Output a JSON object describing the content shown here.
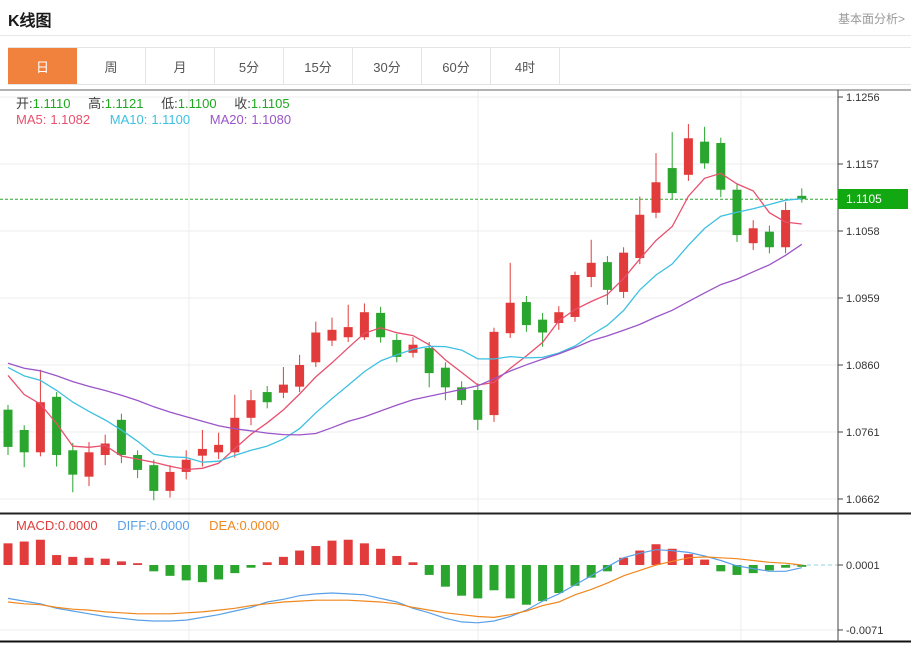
{
  "header": {
    "title": "K线图",
    "link": "基本面分析>"
  },
  "tabs": {
    "items": [
      "日",
      "周",
      "月",
      "5分",
      "15分",
      "30分",
      "60分",
      "4时"
    ],
    "active_index": 0
  },
  "legend": {
    "ohlc": [
      {
        "label": "开:",
        "value": "1.1110"
      },
      {
        "label": "高:",
        "value": "1.1121"
      },
      {
        "label": "低:",
        "value": "1.1100"
      },
      {
        "label": "收:",
        "value": "1.1105"
      }
    ],
    "ma": [
      {
        "label": "MA5:",
        "value": "1.1082",
        "color": "#e8506e"
      },
      {
        "label": "MA10:",
        "value": "1.1100",
        "color": "#3ec0e0"
      },
      {
        "label": "MA20:",
        "value": "1.1080",
        "color": "#9b55c8"
      }
    ]
  },
  "macd_legend": [
    {
      "label": "MACD:",
      "value": "0.0000",
      "color": "#e13b3b"
    },
    {
      "label": "DIFF:",
      "value": "0.0000",
      "color": "#5aa0e6"
    },
    {
      "label": "DEA:",
      "value": "0.0000",
      "color": "#f0871e"
    }
  ],
  "price_badge": {
    "value": "1.1105"
  },
  "colors": {
    "up": "#e13b3b",
    "down": "#2aa52d",
    "badge": "#12a812",
    "dashed_price": "#2fa82f",
    "ma5": "#e8506e",
    "ma10": "#3ec0e0",
    "ma20": "#9b55c8",
    "diff": "#5aa0e6",
    "dea": "#f0871e",
    "tab_active": "#f0823d",
    "grid": "#ededed",
    "axis_text": "#333333"
  },
  "chart_data": {
    "type": "candlestick",
    "title": "K线图",
    "current_price": 1.1105,
    "y_axis": {
      "labels": [
        "1.1256",
        "1.1157",
        "1.1058",
        "1.0959",
        "1.0860",
        "1.0761",
        "1.0662"
      ],
      "values": [
        1.1256,
        1.1157,
        1.1058,
        1.0959,
        1.086,
        1.0761,
        1.0662
      ]
    },
    "candles": [
      [
        1.0794,
        1.0801,
        1.0727,
        1.0739
      ],
      [
        1.0764,
        1.0771,
        1.0709,
        1.0731
      ],
      [
        1.0731,
        1.0853,
        1.0725,
        1.0805
      ],
      [
        1.0813,
        1.082,
        1.071,
        1.0727
      ],
      [
        1.0734,
        1.0745,
        1.0672,
        1.0698
      ],
      [
        1.0695,
        1.0746,
        1.0681,
        1.0731
      ],
      [
        1.0727,
        1.0757,
        1.0712,
        1.0744
      ],
      [
        1.0779,
        1.0788,
        1.0715,
        1.0727
      ],
      [
        1.0727,
        1.0734,
        1.0693,
        1.0705
      ],
      [
        1.0712,
        1.072,
        1.066,
        1.0674
      ],
      [
        1.0674,
        1.0712,
        1.0664,
        1.0702
      ],
      [
        1.0702,
        1.0734,
        1.0691,
        1.072
      ],
      [
        1.0726,
        1.0764,
        1.071,
        1.0736
      ],
      [
        1.0731,
        1.076,
        1.0721,
        1.0742
      ],
      [
        1.0731,
        1.0816,
        1.0723,
        1.0782
      ],
      [
        1.0782,
        1.0823,
        1.0771,
        1.0808
      ],
      [
        1.082,
        1.0829,
        1.0796,
        1.0805
      ],
      [
        1.0819,
        1.0857,
        1.0811,
        1.0831
      ],
      [
        1.0828,
        1.0875,
        1.082,
        1.086
      ],
      [
        1.0864,
        1.0924,
        1.0857,
        1.0908
      ],
      [
        1.0896,
        1.093,
        1.0888,
        1.0912
      ],
      [
        1.0901,
        1.0949,
        1.0894,
        1.0916
      ],
      [
        1.0901,
        1.0951,
        1.0897,
        1.0938
      ],
      [
        1.0937,
        1.0946,
        1.0893,
        1.0901
      ],
      [
        1.0897,
        1.0906,
        1.0864,
        1.0872
      ],
      [
        1.0878,
        1.0901,
        1.0871,
        1.089
      ],
      [
        1.0885,
        1.0894,
        1.0827,
        1.0848
      ],
      [
        1.0856,
        1.0864,
        1.0808,
        1.0827
      ],
      [
        1.0827,
        1.0836,
        1.0801,
        1.0808
      ],
      [
        1.0823,
        1.0833,
        1.0764,
        1.0779
      ],
      [
        1.0786,
        1.0915,
        1.0776,
        1.0909
      ],
      [
        1.0907,
        1.1011,
        1.09,
        1.0952
      ],
      [
        1.0953,
        1.0962,
        1.0909,
        1.0919
      ],
      [
        1.0927,
        1.0937,
        1.0887,
        1.0908
      ],
      [
        1.0922,
        1.0947,
        1.0912,
        1.0938
      ],
      [
        1.0931,
        1.0998,
        1.0924,
        1.0993
      ],
      [
        1.099,
        1.1045,
        1.0975,
        1.1011
      ],
      [
        1.1012,
        1.1021,
        1.0949,
        1.0971
      ],
      [
        1.0968,
        1.1034,
        1.0959,
        1.1026
      ],
      [
        1.1018,
        1.1109,
        1.1009,
        1.1082
      ],
      [
        1.1085,
        1.1173,
        1.1077,
        1.113
      ],
      [
        1.1151,
        1.1204,
        1.1105,
        1.1114
      ],
      [
        1.1141,
        1.1216,
        1.1132,
        1.1195
      ],
      [
        1.119,
        1.1212,
        1.115,
        1.1158
      ],
      [
        1.1188,
        1.1196,
        1.1108,
        1.1119
      ],
      [
        1.1119,
        1.1127,
        1.1042,
        1.1052
      ],
      [
        1.104,
        1.1074,
        1.103,
        1.1062
      ],
      [
        1.1057,
        1.1066,
        1.1025,
        1.1034
      ],
      [
        1.1034,
        1.1101,
        1.1025,
        1.1089
      ],
      [
        1.111,
        1.1121,
        1.11,
        1.1105
      ]
    ],
    "ma_seed_closes": [
      1.088,
      1.0878,
      1.0875,
      1.0872,
      1.087,
      1.0868,
      1.0865,
      1.0862,
      1.086,
      1.0858,
      1.0856,
      1.0872,
      1.0875,
      1.087,
      1.0868,
      1.0872,
      1.0876,
      1.087,
      1.0866
    ],
    "macd": {
      "y_axis": {
        "labels": [
          "0.0001",
          "-0.0071"
        ],
        "values": [
          0.0001,
          -0.0071
        ]
      },
      "hist": [
        0.0025,
        0.0027,
        0.0029,
        0.0012,
        0.001,
        0.0009,
        0.0008,
        0.0005,
        0.0003,
        -0.0006,
        -0.0011,
        -0.0016,
        -0.0018,
        -0.0015,
        -0.0008,
        -0.0002,
        0.0004,
        0.001,
        0.0017,
        0.0022,
        0.0028,
        0.0029,
        0.0025,
        0.0019,
        0.0011,
        0.0004,
        -0.001,
        -0.0023,
        -0.0033,
        -0.0036,
        -0.0027,
        -0.0036,
        -0.0043,
        -0.0039,
        -0.003,
        -0.0022,
        -0.0013,
        -0.0006,
        0.0009,
        0.0017,
        0.0024,
        0.0019,
        0.0013,
        0.0007,
        -0.0006,
        -0.001,
        -0.0008,
        -0.0005,
        -0.0002,
        -0.0001
      ],
      "diff": [
        -0.0036,
        -0.0039,
        -0.0042,
        -0.0047,
        -0.005,
        -0.0053,
        -0.0056,
        -0.0058,
        -0.006,
        -0.0061,
        -0.0061,
        -0.006,
        -0.0057,
        -0.0054,
        -0.005,
        -0.0046,
        -0.004,
        -0.0037,
        -0.0033,
        -0.0031,
        -0.003,
        -0.0031,
        -0.0032,
        -0.0036,
        -0.004,
        -0.0047,
        -0.0052,
        -0.0058,
        -0.0062,
        -0.0063,
        -0.0061,
        -0.0056,
        -0.0049,
        -0.0039,
        -0.0031,
        -0.0021,
        -0.0011,
        -0.0001,
        0.0009,
        0.0014,
        0.0018,
        0.0017,
        0.0015,
        0.0011,
        0.0006,
        0.0,
        -0.0003,
        -0.0006,
        -0.0006,
        -0.0002
      ],
      "dea": [
        -0.004,
        -0.0042,
        -0.0043,
        -0.0046,
        -0.0048,
        -0.0049,
        -0.0051,
        -0.0052,
        -0.0053,
        -0.0053,
        -0.0053,
        -0.0052,
        -0.0051,
        -0.0049,
        -0.0047,
        -0.0044,
        -0.0042,
        -0.004,
        -0.0039,
        -0.0038,
        -0.0038,
        -0.0038,
        -0.0039,
        -0.004,
        -0.0042,
        -0.0046,
        -0.0049,
        -0.0052,
        -0.0054,
        -0.0056,
        -0.0057,
        -0.0054,
        -0.005,
        -0.0044,
        -0.004,
        -0.0032,
        -0.0026,
        -0.0019,
        -0.0011,
        -0.0005,
        0.0001,
        0.0005,
        0.0009,
        0.001,
        0.0009,
        0.0008,
        0.0006,
        0.0004,
        0.0003,
        0.0001
      ]
    }
  }
}
